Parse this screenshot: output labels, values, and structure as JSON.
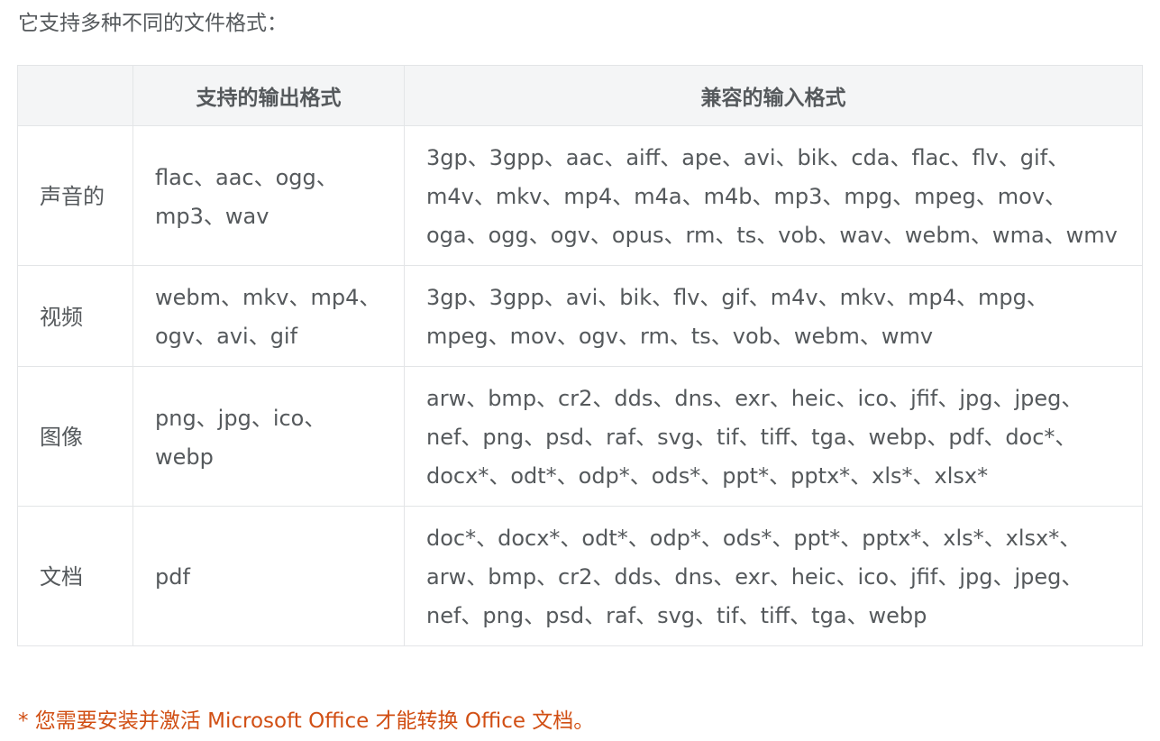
{
  "intro": "它支持多种不同的文件格式：",
  "table": {
    "headers": [
      "",
      "支持的输出格式",
      "兼容的输入格式"
    ],
    "rows": [
      {
        "type": "声音的",
        "output": "flac、aac、ogg、mp3、wav",
        "input": "3gp、3gpp、aac、aiff、ape、avi、bik、cda、flac、flv、gif、m4v、mkv、mp4、m4a、m4b、mp3、mpg、mpeg、mov、oga、ogg、ogv、opus、rm、ts、vob、wav、webm、wma、wmv"
      },
      {
        "type": "视频",
        "output": "webm、mkv、mp4、ogv、avi、gif",
        "input": "3gp、3gpp、avi、bik、flv、gif、m4v、mkv、mp4、mpg、mpeg、mov、ogv、rm、ts、vob、webm、wmv"
      },
      {
        "type": "图像",
        "output": "png、jpg、ico、webp",
        "input": "arw、bmp、cr2、dds、dns、exr、heic、ico、jfif、jpg、jpeg、nef、png、psd、raf、svg、tif、tiff、tga、webp、pdf、doc*、docx*、odt*、odp*、ods*、ppt*、pptx*、xls*、xlsx*"
      },
      {
        "type": "文档",
        "output": "pdf",
        "input": "doc*、docx*、odt*、odp*、ods*、ppt*、pptx*、xls*、xlsx*、arw、bmp、cr2、dds、dns、exr、heic、ico、jfif、jpg、jpeg、nef、png、psd、raf、svg、tif、tiff、tga、webp"
      }
    ]
  },
  "note": "* 您需要安装并激活 Microsoft Office 才能转换 Office 文档。",
  "colors": {
    "text": "#55595c",
    "header_bg": "#f4f5f6",
    "border": "#e3e5e7",
    "note": "#d14f14"
  }
}
